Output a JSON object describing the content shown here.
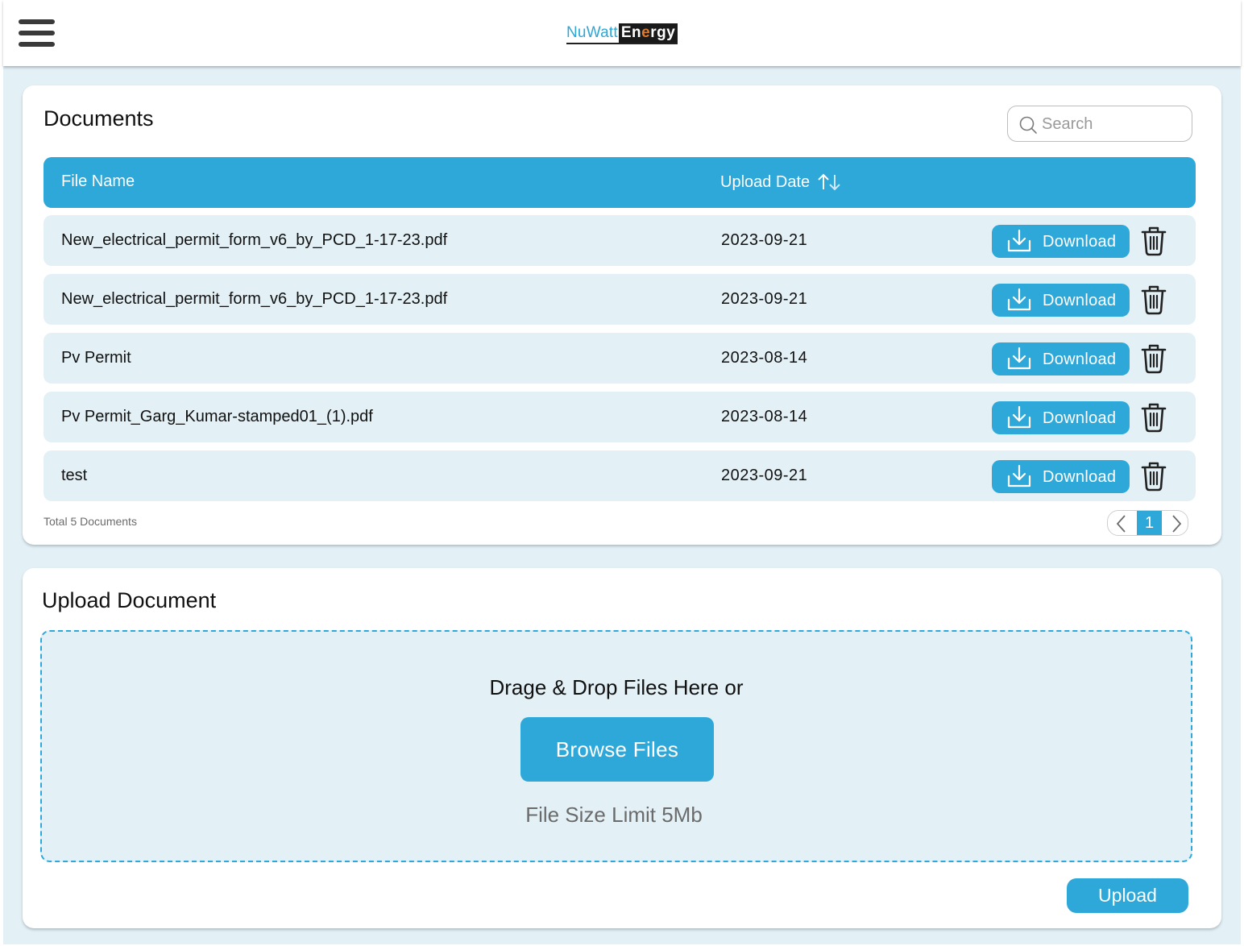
{
  "header": {
    "logo_part1": "NuWatt",
    "logo_part2_a": "En",
    "logo_part2_dot": "e",
    "logo_part2_b": "rgy"
  },
  "documents": {
    "title": "Documents",
    "search_placeholder": "Search",
    "columns": {
      "file_name": "File Name",
      "upload_date": "Upload Date"
    },
    "rows": [
      {
        "file_name": "New_electrical_permit_form_v6_by_PCD_1-17-23.pdf",
        "upload_date": "2023-09-21",
        "action_label": "Download"
      },
      {
        "file_name": "New_electrical_permit_form_v6_by_PCD_1-17-23.pdf",
        "upload_date": "2023-09-21",
        "action_label": "Download"
      },
      {
        "file_name": "Pv Permit",
        "upload_date": "2023-08-14",
        "action_label": "Download"
      },
      {
        "file_name": "Pv Permit_Garg_Kumar-stamped01_(1).pdf",
        "upload_date": "2023-08-14",
        "action_label": "Download"
      },
      {
        "file_name": "test",
        "upload_date": "2023-09-21",
        "action_label": "Download"
      }
    ],
    "total_label": "Total 5 Documents",
    "pagination": {
      "current_page": "1"
    }
  },
  "upload": {
    "title": "Upload Document",
    "dropzone_text": "Drage & Drop Files Here or",
    "browse_label": "Browse Files",
    "size_limit": "File Size Limit 5Mb",
    "upload_label": "Upload"
  },
  "icons": {
    "menu": "hamburger-menu-icon",
    "search": "search-icon",
    "sort": "sort-arrows-icon",
    "download": "download-icon",
    "delete": "trash-icon",
    "prev": "chevron-left-icon",
    "next": "chevron-right-icon"
  },
  "colors": {
    "accent": "#2ea8d9",
    "page_background": "#e3f1f7",
    "row_background": "#e3f1f7",
    "card_background": "#ffffff"
  }
}
